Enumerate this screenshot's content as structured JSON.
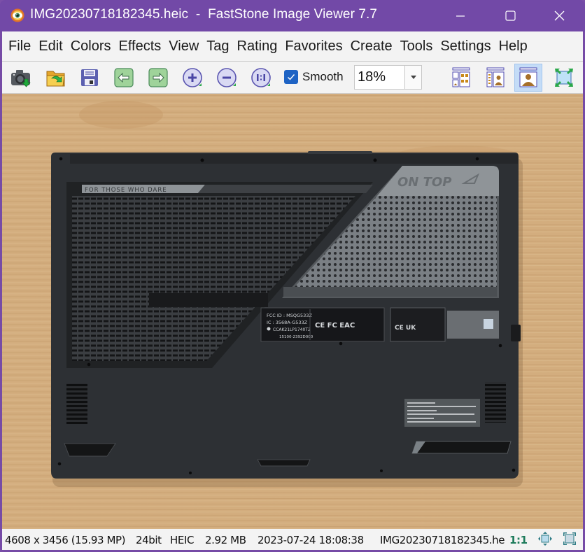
{
  "window": {
    "title": "IMG20230718182345.heic  -  FastStone Image Viewer 7.7",
    "app_icon": "eye-icon",
    "controls": [
      "minimize",
      "maximize",
      "close"
    ]
  },
  "menu": {
    "items": [
      {
        "label": "File"
      },
      {
        "label": "Edit"
      },
      {
        "label": "Colors"
      },
      {
        "label": "Effects"
      },
      {
        "label": "View"
      },
      {
        "label": "Tag"
      },
      {
        "label": "Rating"
      },
      {
        "label": "Favorites"
      },
      {
        "label": "Create"
      },
      {
        "label": "Tools"
      },
      {
        "label": "Settings"
      },
      {
        "label": "Help"
      }
    ]
  },
  "toolbar": {
    "buttons": [
      {
        "name": "acquire-camera",
        "icon": "camera-download-icon"
      },
      {
        "name": "open-folder",
        "icon": "folder-open-icon"
      },
      {
        "name": "save",
        "icon": "floppy-disk-icon"
      },
      {
        "name": "previous",
        "icon": "arrow-left-icon"
      },
      {
        "name": "next",
        "icon": "arrow-right-icon"
      },
      {
        "name": "zoom-in",
        "icon": "zoom-in-icon"
      },
      {
        "name": "zoom-out",
        "icon": "zoom-out-icon"
      },
      {
        "name": "actual-size",
        "icon": "actual-size-icon"
      }
    ],
    "smooth": {
      "label": "Smooth",
      "checked": true
    },
    "zoom": {
      "value": "18%"
    },
    "view_modes": [
      {
        "name": "thumbnails-grid",
        "icon": "thumbnail-grid-icon",
        "active": false
      },
      {
        "name": "browser-preview",
        "icon": "browser-preview-icon",
        "active": false
      },
      {
        "name": "image-view",
        "icon": "image-view-icon",
        "active": true
      },
      {
        "name": "fullscreen",
        "icon": "fullscreen-icon",
        "active": false
      }
    ]
  },
  "image": {
    "description": "Underside of a black ASUS ROG gaming laptop on a wooden table",
    "labels": {
      "slogan": "FOR THOSE WHO DARE",
      "badge": "ON TOP",
      "fcc_id": "FCC ID : MSQG533Z",
      "ic": "IC : 3568A-G533Z",
      "ccai": "CCAK21LP1740T2",
      "serial": "15100-2392D000"
    }
  },
  "status": {
    "dimensions": "4608 x 3456 (15.93 MP)",
    "bit_depth": "24bit",
    "format": "HEIC",
    "file_size": "2.92 MB",
    "datetime": "2023-07-24 18:08:38",
    "filename": "IMG20230718182345.he",
    "ratio": "1:1",
    "fit_icon": "fit-window-icon",
    "full_icon": "fullscreen-icon"
  },
  "colors": {
    "titlebar": "#7249a7",
    "accent": "#1e63c4",
    "active_view": "#c4dcf7",
    "ratio_text": "#1c7a5a"
  }
}
